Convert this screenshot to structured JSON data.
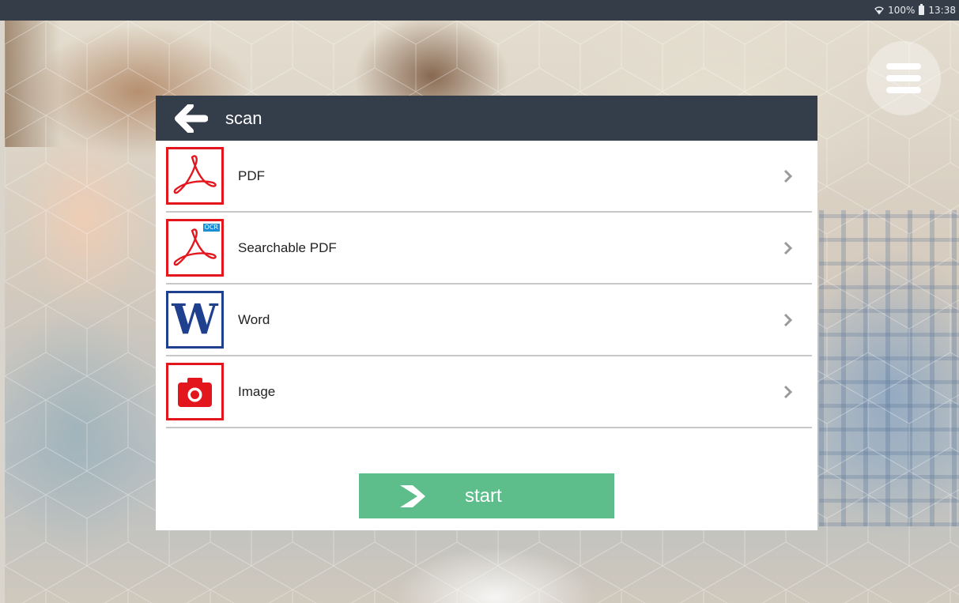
{
  "status_bar": {
    "wifi_icon": "wifi-icon",
    "battery_percent": "100%",
    "battery_icon": "battery-icon",
    "time": "13:38"
  },
  "menu": {
    "icon": "hamburger-menu-icon"
  },
  "dialog": {
    "back_icon": "arrow-left-icon",
    "title": "scan",
    "options": [
      {
        "label": "PDF",
        "icon": "pdf-icon",
        "color": "#e3161e"
      },
      {
        "label": "Searchable PDF",
        "icon": "pdf-ocr-icon",
        "badge": "OCR",
        "color": "#e3161e"
      },
      {
        "label": "Word",
        "icon": "word-icon",
        "glyph": "W",
        "color": "#1f3f8f"
      },
      {
        "label": "Image",
        "icon": "camera-icon",
        "color": "#e3161e"
      }
    ],
    "start_button": {
      "label": "start",
      "icon": "scanner-icon",
      "color": "#5dbe8c"
    }
  },
  "colors": {
    "header_bg": "#343d4a",
    "status_bar_bg": "#353d49",
    "divider": "#c8c8c8"
  }
}
